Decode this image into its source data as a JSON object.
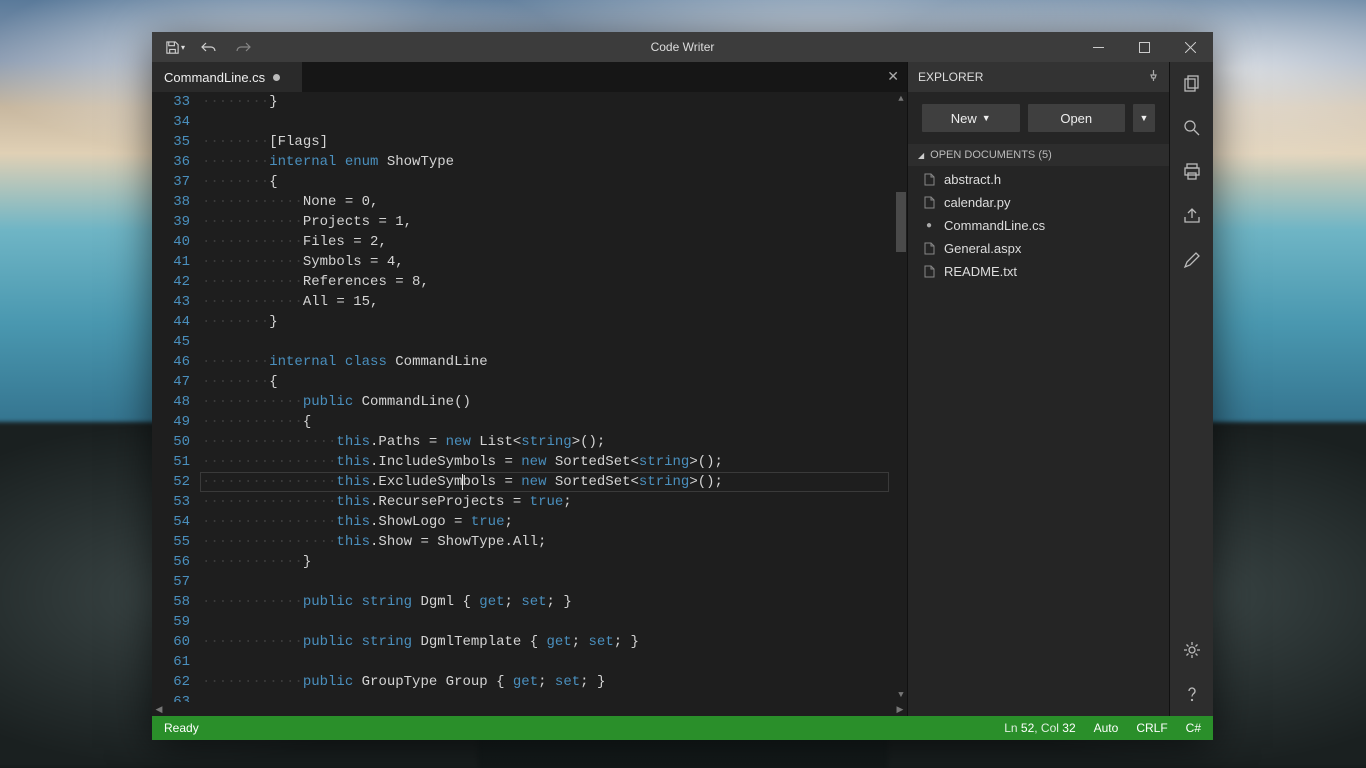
{
  "app": {
    "title": "Code Writer"
  },
  "tabs": {
    "active": {
      "label": "CommandLine.cs",
      "dirty": true
    }
  },
  "explorer": {
    "title": "EXPLORER",
    "new_label": "New",
    "open_label": "Open",
    "open_docs_label": "OPEN DOCUMENTS (5)",
    "files": [
      {
        "name": "abstract.h",
        "dirty": false
      },
      {
        "name": "calendar.py",
        "dirty": false
      },
      {
        "name": "CommandLine.cs",
        "dirty": true
      },
      {
        "name": "General.aspx",
        "dirty": false
      },
      {
        "name": "README.txt",
        "dirty": false
      }
    ]
  },
  "editor": {
    "first_line": 33,
    "current_line": 52,
    "lines": [
      [
        [
          "ws",
          "········"
        ],
        [
          "pln",
          "}"
        ]
      ],
      [],
      [
        [
          "ws",
          "········"
        ],
        [
          "pln",
          "[Flags]"
        ]
      ],
      [
        [
          "ws",
          "········"
        ],
        [
          "kw",
          "internal"
        ],
        [
          "pln",
          " "
        ],
        [
          "kw",
          "enum"
        ],
        [
          "pln",
          " ShowType"
        ]
      ],
      [
        [
          "ws",
          "········"
        ],
        [
          "pln",
          "{"
        ]
      ],
      [
        [
          "ws",
          "············"
        ],
        [
          "pln",
          "None = 0,"
        ]
      ],
      [
        [
          "ws",
          "············"
        ],
        [
          "pln",
          "Projects = 1,"
        ]
      ],
      [
        [
          "ws",
          "············"
        ],
        [
          "pln",
          "Files = 2,"
        ]
      ],
      [
        [
          "ws",
          "············"
        ],
        [
          "pln",
          "Symbols = 4,"
        ]
      ],
      [
        [
          "ws",
          "············"
        ],
        [
          "pln",
          "References = 8,"
        ]
      ],
      [
        [
          "ws",
          "············"
        ],
        [
          "pln",
          "All = 15,"
        ]
      ],
      [
        [
          "ws",
          "········"
        ],
        [
          "pln",
          "}"
        ]
      ],
      [],
      [
        [
          "ws",
          "········"
        ],
        [
          "kw",
          "internal"
        ],
        [
          "pln",
          " "
        ],
        [
          "kw",
          "class"
        ],
        [
          "pln",
          " CommandLine"
        ]
      ],
      [
        [
          "ws",
          "········"
        ],
        [
          "pln",
          "{"
        ]
      ],
      [
        [
          "ws",
          "············"
        ],
        [
          "kw",
          "public"
        ],
        [
          "pln",
          " CommandLine()"
        ]
      ],
      [
        [
          "ws",
          "············"
        ],
        [
          "pln",
          "{"
        ]
      ],
      [
        [
          "ws",
          "················"
        ],
        [
          "this",
          "this"
        ],
        [
          "pln",
          ".Paths = "
        ],
        [
          "kw",
          "new"
        ],
        [
          "pln",
          " List<"
        ],
        [
          "type",
          "string"
        ],
        [
          "pln",
          ">();"
        ]
      ],
      [
        [
          "ws",
          "················"
        ],
        [
          "this",
          "this"
        ],
        [
          "pln",
          ".IncludeSymbols = "
        ],
        [
          "kw",
          "new"
        ],
        [
          "pln",
          " SortedSet<"
        ],
        [
          "type",
          "string"
        ],
        [
          "pln",
          ">();"
        ]
      ],
      [
        [
          "ws",
          "················"
        ],
        [
          "this",
          "this"
        ],
        [
          "pln",
          ".ExcludeSymbols = "
        ],
        [
          "kw",
          "new"
        ],
        [
          "pln",
          " SortedSet<"
        ],
        [
          "type",
          "string"
        ],
        [
          "pln",
          ">();"
        ]
      ],
      [
        [
          "ws",
          "················"
        ],
        [
          "this",
          "this"
        ],
        [
          "pln",
          ".RecurseProjects = "
        ],
        [
          "bool",
          "true"
        ],
        [
          "pln",
          ";"
        ]
      ],
      [
        [
          "ws",
          "················"
        ],
        [
          "this",
          "this"
        ],
        [
          "pln",
          ".ShowLogo = "
        ],
        [
          "bool",
          "true"
        ],
        [
          "pln",
          ";"
        ]
      ],
      [
        [
          "ws",
          "················"
        ],
        [
          "this",
          "this"
        ],
        [
          "pln",
          ".Show = ShowType.All;"
        ]
      ],
      [
        [
          "ws",
          "············"
        ],
        [
          "pln",
          "}"
        ]
      ],
      [],
      [
        [
          "ws",
          "············"
        ],
        [
          "kw",
          "public"
        ],
        [
          "pln",
          " "
        ],
        [
          "type",
          "string"
        ],
        [
          "pln",
          " Dgml { "
        ],
        [
          "acc",
          "get"
        ],
        [
          "pln",
          "; "
        ],
        [
          "acc",
          "set"
        ],
        [
          "pln",
          "; }"
        ]
      ],
      [],
      [
        [
          "ws",
          "············"
        ],
        [
          "kw",
          "public"
        ],
        [
          "pln",
          " "
        ],
        [
          "type",
          "string"
        ],
        [
          "pln",
          " DgmlTemplate { "
        ],
        [
          "acc",
          "get"
        ],
        [
          "pln",
          "; "
        ],
        [
          "acc",
          "set"
        ],
        [
          "pln",
          "; }"
        ]
      ],
      [],
      [
        [
          "ws",
          "············"
        ],
        [
          "kw",
          "public"
        ],
        [
          "pln",
          " GroupType Group { "
        ],
        [
          "acc",
          "get"
        ],
        [
          "pln",
          "; "
        ],
        [
          "acc",
          "set"
        ],
        [
          "pln",
          "; }"
        ]
      ],
      []
    ]
  },
  "status": {
    "ready": "Ready",
    "ln_label": "Ln ",
    "ln": "52",
    "col_label": ", Col ",
    "col": "32",
    "wrap": "Auto",
    "eol": "CRLF",
    "lang": "C#"
  }
}
